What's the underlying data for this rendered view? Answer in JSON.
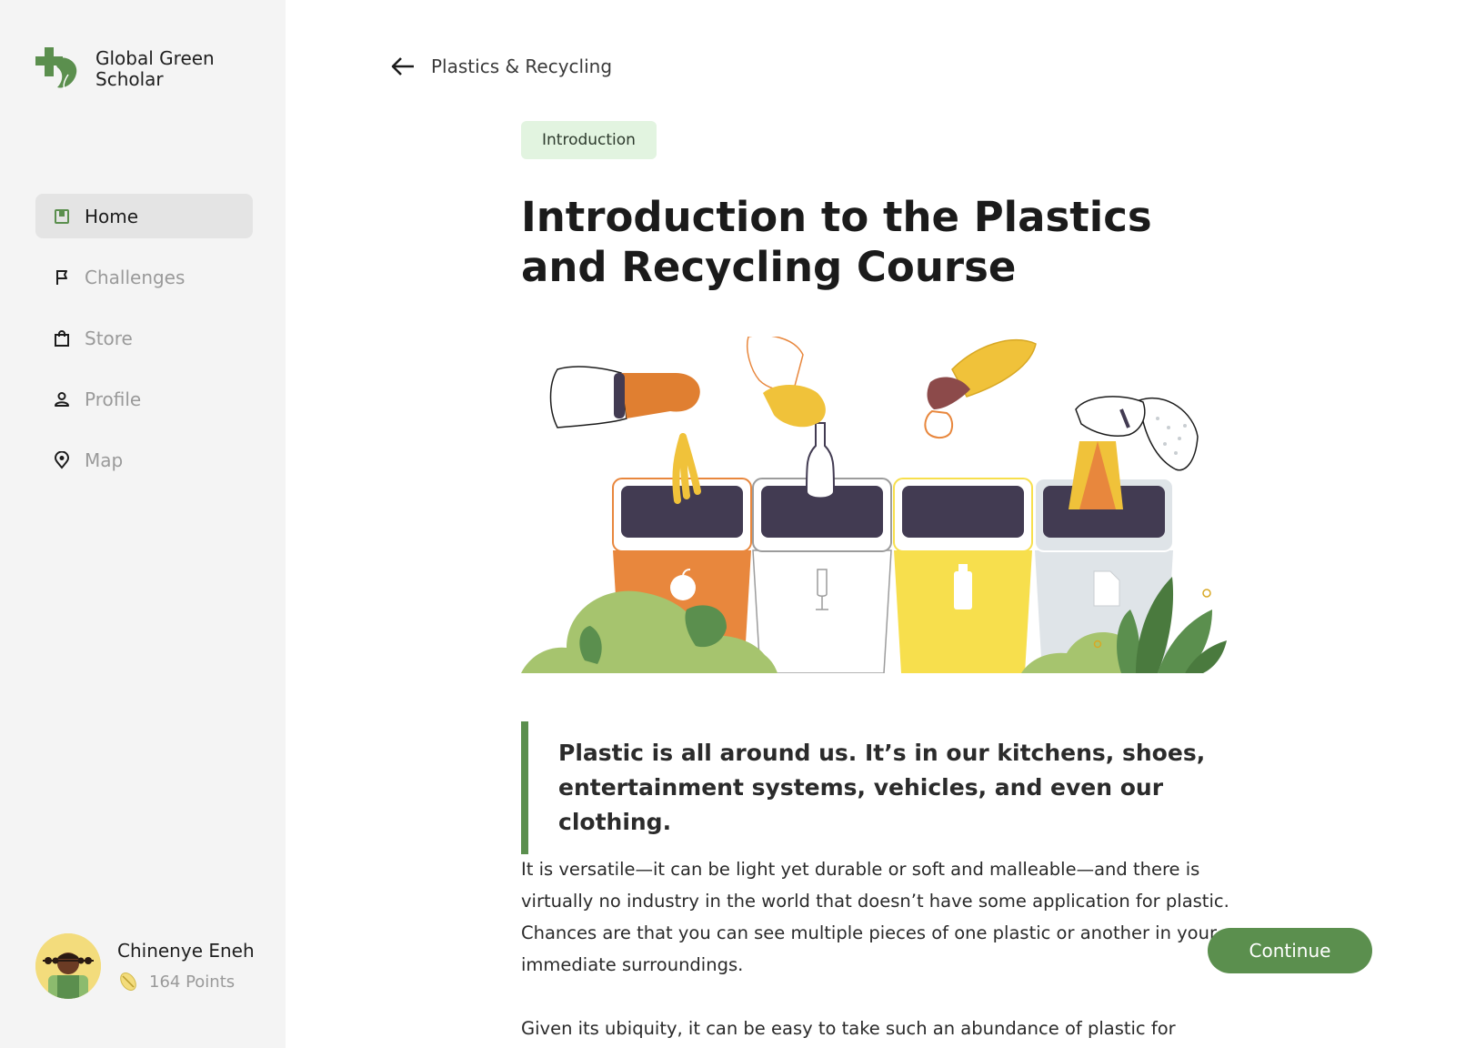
{
  "brand": {
    "name": "Global Green Scholar",
    "color": "#5b8f4e"
  },
  "nav": [
    {
      "label": "Home",
      "icon": "home-icon",
      "active": true
    },
    {
      "label": "Challenges",
      "icon": "flag-icon",
      "active": false
    },
    {
      "label": "Store",
      "icon": "shopping-bag-icon",
      "active": false
    },
    {
      "label": "Profile",
      "icon": "person-icon",
      "active": false
    },
    {
      "label": "Map",
      "icon": "map-pin-icon",
      "active": false
    }
  ],
  "user": {
    "name": "Chinenye Eneh",
    "points": "164 Points",
    "points_icon": "leaf-coin-icon"
  },
  "back": {
    "label": "Plastics & Recycling",
    "icon": "arrow-left-icon"
  },
  "lesson": {
    "badge": "Introduction",
    "title": "Introduction to the Plastics and Recycling Course",
    "quote": "Plastic is all around us. It’s in our kitchens, shoes, entertainment systems, vehicles, and even our clothing.",
    "paragraphs": [
      "It is versatile—it can be light yet durable or soft and malleable—and there is virtually no industry in the world that doesn’t have some application for plastic. Chances are that you can see multiple pieces of one plastic or another in your immediate surroundings.",
      "Given its ubiquity, it can be easy to take such an abundance of plastic for granted."
    ],
    "illustration": "recycling-bins-illustration"
  },
  "actions": {
    "continue_label": "Continue"
  },
  "colors": {
    "accent": "#5b8f4e",
    "badge_bg": "#e2f4e0",
    "sidebar_bg": "#f4f4f4"
  }
}
